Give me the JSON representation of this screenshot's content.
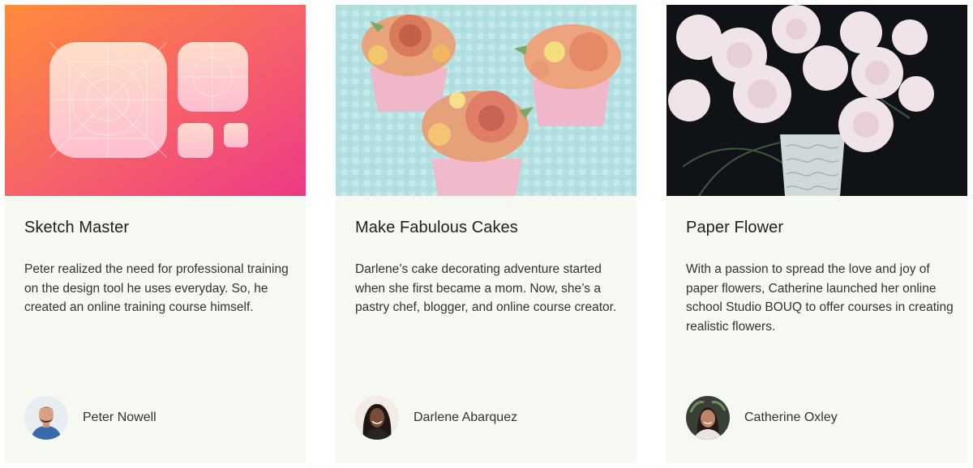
{
  "cards": [
    {
      "title": "Sketch Master",
      "description": "Peter realized the need for professional training on the design tool he uses everyday. So, he created an online training course himself.",
      "author": "Peter Nowell",
      "image": "app-icon-grid-illustration"
    },
    {
      "title": "Make Fabulous Cakes",
      "description": "Darlene’s cake decorating adventure started when she first became a mom. Now, she’s a pastry chef, blogger, and online course creator.",
      "author": "Darlene Abarquez",
      "image": "flower-cupcakes-photo"
    },
    {
      "title": "Paper Flower",
      "description": "With a passion to spread the love and joy of paper flowers, Catherine launched her online school Studio BOUQ to offer courses in creating realistic flowers.",
      "author": "Catherine Oxley",
      "image": "paper-flower-bouquet-photo"
    }
  ],
  "colors": {
    "card_background": "#f6f9f2",
    "title_text": "#1f1f1f",
    "body_text": "#333333",
    "gradient_start": "#ff8a3d",
    "gradient_end": "#ee3f86"
  }
}
